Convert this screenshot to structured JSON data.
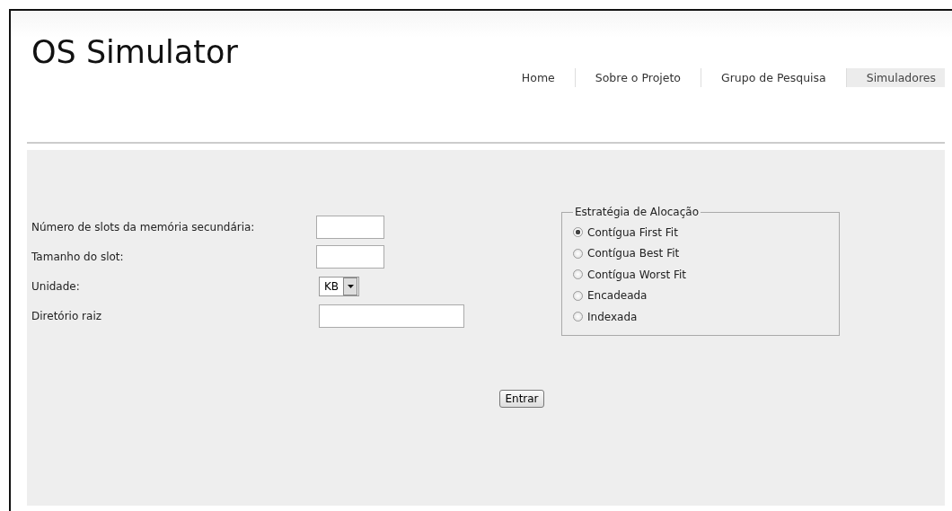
{
  "site": {
    "title": "OS Simulator"
  },
  "nav": [
    {
      "label": "Home",
      "selected": false
    },
    {
      "label": "Sobre o Projeto",
      "selected": false
    },
    {
      "label": "Grupo de Pesquisa",
      "selected": false
    },
    {
      "label": "Simuladores",
      "selected": true
    }
  ],
  "form": {
    "fields": [
      {
        "label": "Número de slots da memória secundária:",
        "kind": "short"
      },
      {
        "label": "Tamanho do slot:",
        "kind": "short"
      },
      {
        "label": "Unidade:",
        "kind": "select",
        "value": "KB"
      },
      {
        "label": "Diretório raiz",
        "kind": "long"
      }
    ],
    "strategy": {
      "legend": "Estratégia de Alocação",
      "options": [
        {
          "label": "Contígua First Fit",
          "selected": true
        },
        {
          "label": "Contígua Best Fit",
          "selected": false
        },
        {
          "label": "Contígua Worst Fit",
          "selected": false
        },
        {
          "label": "Encadeada",
          "selected": false
        },
        {
          "label": "Indexada",
          "selected": false
        }
      ]
    },
    "submit": "Entrar"
  }
}
